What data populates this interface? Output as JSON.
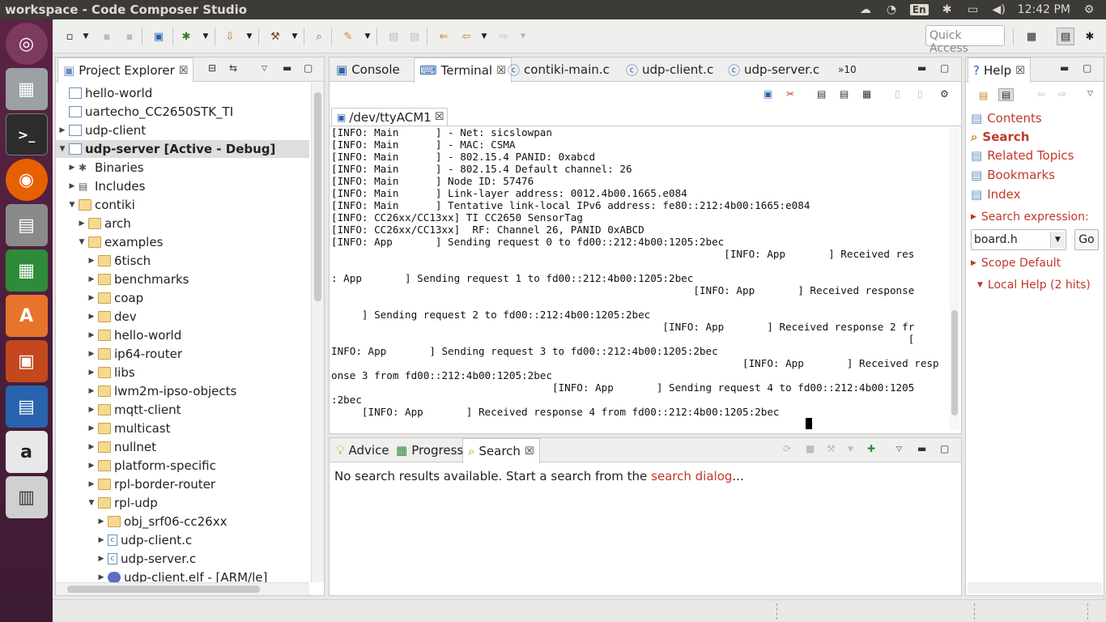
{
  "window": {
    "title": "workspace - Code Composer Studio"
  },
  "tray": {
    "lang": "En",
    "time": "12:42 PM"
  },
  "toolbar": {
    "quick_access": "Quick Access"
  },
  "project_explorer": {
    "tab_label": "Project Explorer",
    "rows": [
      {
        "label": "hello-world",
        "depth": 0,
        "twisty": "",
        "icon": "project"
      },
      {
        "label": "uartecho_CC2650STK_TI",
        "depth": 0,
        "twisty": "",
        "icon": "project"
      },
      {
        "label": "udp-client",
        "depth": 0,
        "twisty": "▶",
        "icon": "project"
      },
      {
        "label": "udp-server  [Active - Debug]",
        "depth": 0,
        "twisty": "▼",
        "icon": "project",
        "selected": true,
        "bold": true
      },
      {
        "label": "Binaries",
        "depth": 1,
        "twisty": "▶",
        "icon": "binaries"
      },
      {
        "label": "Includes",
        "depth": 1,
        "twisty": "▶",
        "icon": "includes"
      },
      {
        "label": "contiki",
        "depth": 1,
        "twisty": "▼",
        "icon": "folder"
      },
      {
        "label": "arch",
        "depth": 2,
        "twisty": "▶",
        "icon": "folder"
      },
      {
        "label": "examples",
        "depth": 2,
        "twisty": "▼",
        "icon": "folder"
      },
      {
        "label": "6tisch",
        "depth": 3,
        "twisty": "▶",
        "icon": "folder"
      },
      {
        "label": "benchmarks",
        "depth": 3,
        "twisty": "▶",
        "icon": "folder"
      },
      {
        "label": "coap",
        "depth": 3,
        "twisty": "▶",
        "icon": "folder"
      },
      {
        "label": "dev",
        "depth": 3,
        "twisty": "▶",
        "icon": "folder"
      },
      {
        "label": "hello-world",
        "depth": 3,
        "twisty": "▶",
        "icon": "folder"
      },
      {
        "label": "ip64-router",
        "depth": 3,
        "twisty": "▶",
        "icon": "folder"
      },
      {
        "label": "libs",
        "depth": 3,
        "twisty": "▶",
        "icon": "folder"
      },
      {
        "label": "lwm2m-ipso-objects",
        "depth": 3,
        "twisty": "▶",
        "icon": "folder"
      },
      {
        "label": "mqtt-client",
        "depth": 3,
        "twisty": "▶",
        "icon": "folder"
      },
      {
        "label": "multicast",
        "depth": 3,
        "twisty": "▶",
        "icon": "folder"
      },
      {
        "label": "nullnet",
        "depth": 3,
        "twisty": "▶",
        "icon": "folder"
      },
      {
        "label": "platform-specific",
        "depth": 3,
        "twisty": "▶",
        "icon": "folder"
      },
      {
        "label": "rpl-border-router",
        "depth": 3,
        "twisty": "▶",
        "icon": "folder"
      },
      {
        "label": "rpl-udp",
        "depth": 3,
        "twisty": "▼",
        "icon": "folder"
      },
      {
        "label": "obj_srf06-cc26xx",
        "depth": 4,
        "twisty": "▶",
        "icon": "folder"
      },
      {
        "label": "udp-client.c",
        "depth": 4,
        "twisty": "▶",
        "icon": "cfile"
      },
      {
        "label": "udp-server.c",
        "depth": 4,
        "twisty": "▶",
        "icon": "cfile"
      },
      {
        "label": "udp-client.elf - [ARM/le]",
        "depth": 4,
        "twisty": "▶",
        "icon": "elf"
      }
    ]
  },
  "editor_tabs": [
    {
      "label": "Console",
      "icon": "console-icon"
    },
    {
      "label": "Terminal",
      "icon": "terminal-icon",
      "active": true,
      "close": "☒"
    },
    {
      "label": "contiki-main.c",
      "icon": "c-file-icon"
    },
    {
      "label": "udp-client.c",
      "icon": "c-file-icon"
    },
    {
      "label": "udp-server.c",
      "icon": "c-file-icon"
    },
    {
      "label": "»10",
      "icon": ""
    }
  ],
  "terminal": {
    "session_tab": "/dev/ttyACM1",
    "lines": [
      "[INFO: Main      ] - Net: sicslowpan",
      "[INFO: Main      ] - MAC: CSMA",
      "[INFO: Main      ] - 802.15.4 PANID: 0xabcd",
      "[INFO: Main      ] - 802.15.4 Default channel: 26",
      "[INFO: Main      ] Node ID: 57476",
      "[INFO: Main      ] Link-layer address: 0012.4b00.1665.e084",
      "[INFO: Main      ] Tentative link-local IPv6 address: fe80::212:4b00:1665:e084",
      "[INFO: CC26xx/CC13xx] TI CC2650 SensorTag",
      "[INFO: CC26xx/CC13xx]  RF: Channel 26, PANID 0xABCD",
      "[INFO: App       ] Sending request 0 to fd00::212:4b00:1205:2bec",
      "                                                                [INFO: App       ] Received res",
      "",
      ": App       ] Sending request 1 to fd00::212:4b00:1205:2bec",
      "                                                           [INFO: App       ] Received response",
      "",
      "     ] Sending request 2 to fd00::212:4b00:1205:2bec",
      "                                                      [INFO: App       ] Received response 2 fr",
      "                                                                                              [",
      "INFO: App       ] Sending request 3 to fd00::212:4b00:1205:2bec",
      "                                                                   [INFO: App       ] Received resp",
      "onse 3 from fd00::212:4b00:1205:2bec",
      "                                    [INFO: App       ] Sending request 4 to fd00::212:4b00:1205",
      ":2bec",
      "     [INFO: App       ] Received response 4 from fd00::212:4b00:1205:2bec"
    ]
  },
  "bottom_panel": {
    "tabs": [
      {
        "label": "Advice"
      },
      {
        "label": "Progress"
      },
      {
        "label": "Search",
        "active": true
      }
    ],
    "message_prefix": "No search results available. Start a search from the ",
    "message_link": "search dialog",
    "message_suffix": "..."
  },
  "help": {
    "tab_label": "Help",
    "items": [
      "Contents",
      "Search",
      "Related Topics",
      "Bookmarks",
      "Index"
    ],
    "search_expression_label": "Search expression:",
    "search_value": "board.h",
    "go_label": "Go",
    "scope_label": "Scope Default",
    "local_help_label": "Local Help (2 hits)"
  }
}
